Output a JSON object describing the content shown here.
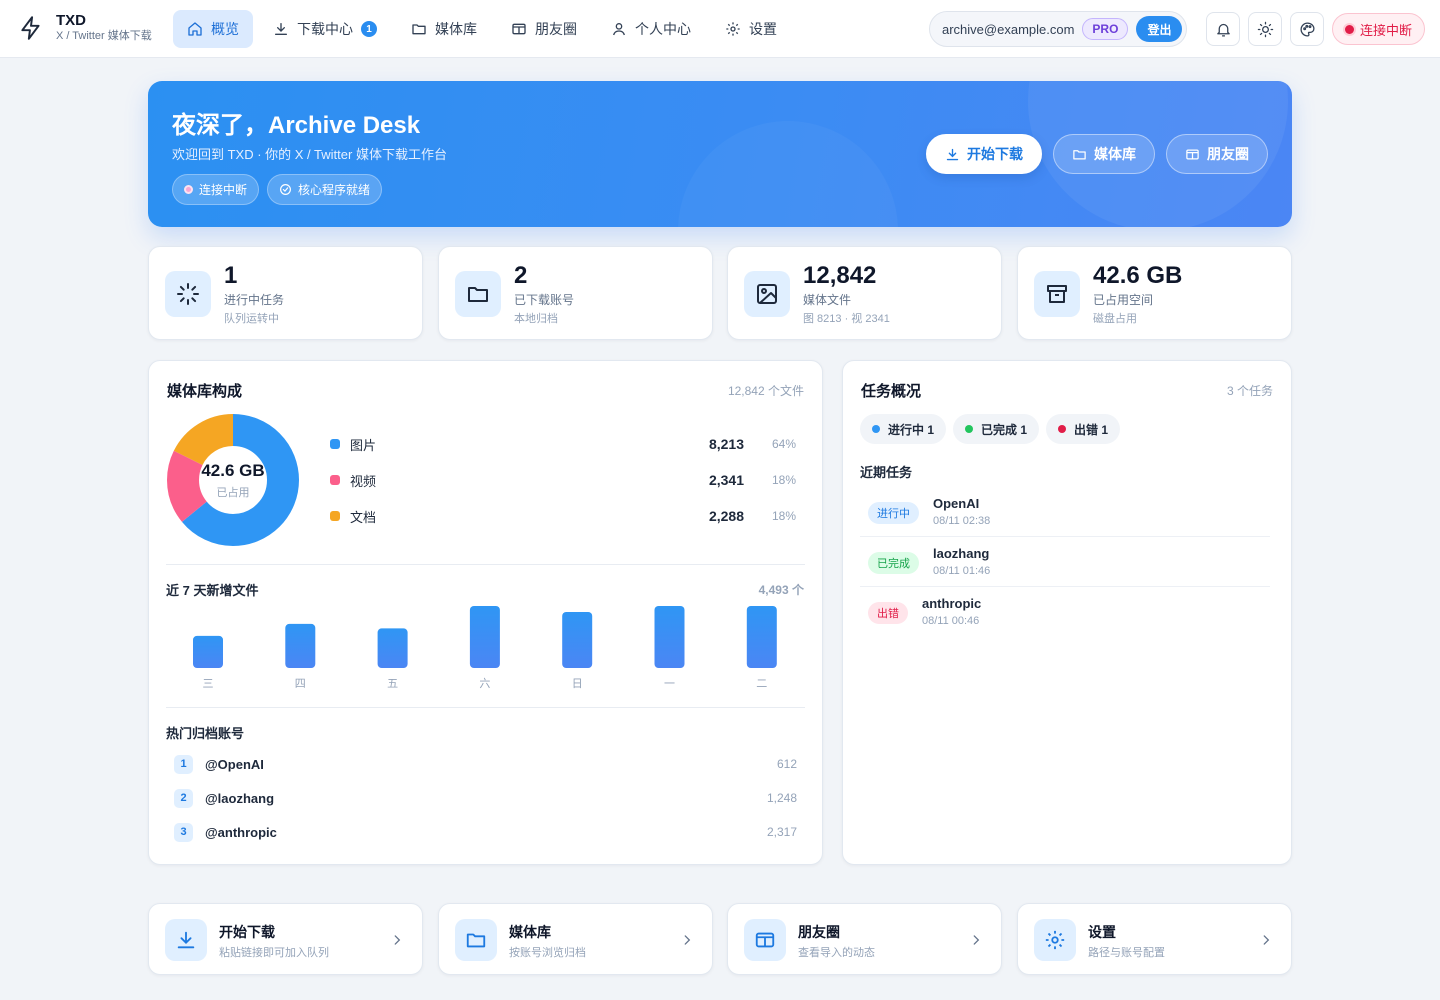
{
  "brand": {
    "name": "TXD",
    "subtitle": "X / Twitter 媒体下载"
  },
  "nav": {
    "items": [
      {
        "label": "概览",
        "icon": "home-icon"
      },
      {
        "label": "下载中心",
        "icon": "download-icon",
        "badge": "1"
      },
      {
        "label": "媒体库",
        "icon": "folder-icon"
      },
      {
        "label": "朋友圈",
        "icon": "moments-icon"
      },
      {
        "label": "个人中心",
        "icon": "user-icon"
      },
      {
        "label": "设置",
        "icon": "gear-icon"
      }
    ]
  },
  "account": {
    "email": "archive@example.com",
    "plan": "PRO",
    "logout": "登出"
  },
  "connection": {
    "label": "连接中断"
  },
  "hero": {
    "title": "夜深了，Archive Desk",
    "subtitle": "欢迎回到 TXD · 你的 X / Twitter 媒体下载工作台",
    "chips": [
      "连接中断",
      "核心程序就绪"
    ],
    "actions": [
      "开始下载",
      "媒体库",
      "朋友圈"
    ]
  },
  "stats": [
    {
      "value": "1",
      "label": "进行中任务",
      "hint": "队列运转中",
      "icon": "loader-icon"
    },
    {
      "value": "2",
      "label": "已下载账号",
      "hint": "本地归档",
      "icon": "folder-icon"
    },
    {
      "value": "12,842",
      "label": "媒体文件",
      "hint": "图 8213 · 视 2341",
      "icon": "image-icon"
    },
    {
      "value": "42.6 GB",
      "label": "已占用空间",
      "hint": "磁盘占用",
      "icon": "archive-icon"
    }
  ],
  "library": {
    "title": "媒体库构成",
    "meta": "12,842 个文件",
    "donut": {
      "value": "42.6 GB",
      "label": "已占用"
    },
    "legend": [
      {
        "name": "图片",
        "count": "8,213",
        "pct": "64%"
      },
      {
        "name": "视频",
        "count": "2,341",
        "pct": "18%"
      },
      {
        "name": "文档",
        "count": "2,288",
        "pct": "18%"
      }
    ],
    "weekly_title": "近 7 天新增文件",
    "weekly_total": "4,493 个",
    "top_title": "热门归档账号",
    "top_accounts": [
      {
        "rank": "1",
        "name": "@OpenAI",
        "count": "612"
      },
      {
        "rank": "2",
        "name": "@laozhang",
        "count": "1,248"
      },
      {
        "rank": "3",
        "name": "@anthropic",
        "count": "2,317"
      }
    ]
  },
  "chart_data": [
    {
      "type": "pie",
      "categories": [
        "图片",
        "视频",
        "文档"
      ],
      "values": [
        8213,
        2341,
        2288
      ],
      "colors": [
        "#2f96f4",
        "#fb5f8b",
        "#f5a623"
      ]
    },
    {
      "type": "bar",
      "categories": [
        "三",
        "四",
        "五",
        "六",
        "日",
        "一",
        "二"
      ],
      "values": [
        430,
        590,
        530,
        830,
        750,
        830,
        830
      ],
      "ylim": [
        0,
        830
      ],
      "grid": false
    }
  ],
  "tasks": {
    "title": "任务概况",
    "meta": "3 个任务",
    "chips": [
      {
        "label": "进行中 1",
        "color": "#2f96f4"
      },
      {
        "label": "已完成 1",
        "color": "#22c55e"
      },
      {
        "label": "出错 1",
        "color": "#e11d48"
      }
    ],
    "recent_title": "近期任务",
    "recent": [
      {
        "status": "进行中",
        "name": "OpenAI",
        "time": "08/11 02:38",
        "bg": "#e0efff",
        "fg": "#1d79e0"
      },
      {
        "status": "已完成",
        "name": "laozhang",
        "time": "08/11 01:46",
        "bg": "#dcfce7",
        "fg": "#16a34a"
      },
      {
        "status": "出错",
        "name": "anthropic",
        "time": "08/11 00:46",
        "bg": "#ffe4ea",
        "fg": "#e11d48"
      }
    ]
  },
  "quick": [
    {
      "title": "开始下载",
      "sub": "粘贴链接即可加入队列",
      "icon": "download-icon"
    },
    {
      "title": "媒体库",
      "sub": "按账号浏览归档",
      "icon": "folder-icon"
    },
    {
      "title": "朋友圈",
      "sub": "查看导入的动态",
      "icon": "moments-icon"
    },
    {
      "title": "设置",
      "sub": "路径与账号配置",
      "icon": "gear-icon"
    }
  ]
}
